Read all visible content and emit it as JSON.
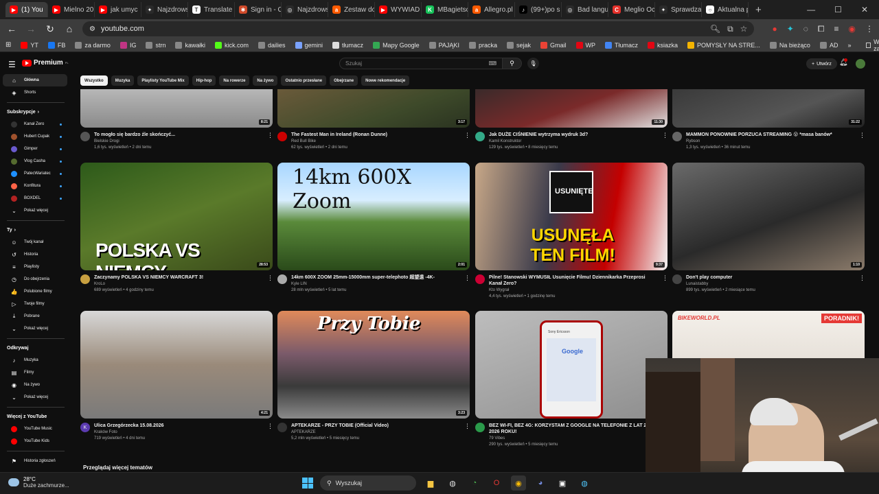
{
  "browser": {
    "tabs": [
      {
        "label": "(1) You",
        "color": "#ff0000",
        "glyph": "▶",
        "active": true
      },
      {
        "label": "Mielno 20",
        "color": "#ff0000",
        "glyph": "▶"
      },
      {
        "label": "jak umyc",
        "color": "#ff0000",
        "glyph": "▶"
      },
      {
        "label": "Najzdrows",
        "color": "#2a2a2a",
        "glyph": "✦"
      },
      {
        "label": "Translate",
        "color": "#ffffff",
        "glyph": "T"
      },
      {
        "label": "Sign in - C",
        "color": "#d04a2a",
        "glyph": "✱"
      },
      {
        "label": "Najzdrows",
        "color": "#2a2a2a",
        "glyph": "◎"
      },
      {
        "label": "Zestaw do",
        "color": "#ff5a00",
        "glyph": "a"
      },
      {
        "label": "WYWIAD",
        "color": "#ff0000",
        "glyph": "▶"
      },
      {
        "label": "MBagietsc",
        "color": "#17c35a",
        "glyph": "K"
      },
      {
        "label": "Allegro.pl",
        "color": "#ff5a00",
        "glyph": "a"
      },
      {
        "label": "(99+)po s",
        "color": "#000000",
        "glyph": "♪"
      },
      {
        "label": "Bad langu",
        "color": "#2a2a2a",
        "glyph": "◎"
      },
      {
        "label": "Meglio Oc",
        "color": "#e5302a",
        "glyph": "C"
      },
      {
        "label": "Sprawdza",
        "color": "#2a2a2a",
        "glyph": "✦"
      },
      {
        "label": "Aktualna p",
        "color": "#ffffff",
        "glyph": "○"
      }
    ],
    "url": "youtube.com",
    "bookmarks": [
      {
        "label": "YT",
        "color": "#ff0000"
      },
      {
        "label": "FB",
        "color": "#1877f2"
      },
      {
        "label": "za darmo",
        "color": "#888888"
      },
      {
        "label": "IG",
        "color": "#c13584"
      },
      {
        "label": "strn",
        "color": "#888888"
      },
      {
        "label": "kawałki",
        "color": "#888888"
      },
      {
        "label": "kick.com",
        "color": "#53fc18"
      },
      {
        "label": "dailies",
        "color": "#888888"
      },
      {
        "label": "gemini",
        "color": "#7aa2ff"
      },
      {
        "label": "tłumacz",
        "color": "#dddddd"
      },
      {
        "label": "Mapy Google",
        "color": "#34a853"
      },
      {
        "label": "PAJĄKI",
        "color": "#888888"
      },
      {
        "label": "pracka",
        "color": "#888888"
      },
      {
        "label": "sejak",
        "color": "#888888"
      },
      {
        "label": "Gmail",
        "color": "#ea4335"
      },
      {
        "label": "WP",
        "color": "#e20613"
      },
      {
        "label": "Tłumacz",
        "color": "#4285f4"
      },
      {
        "label": "ksiazka",
        "color": "#e20613"
      },
      {
        "label": "POMYSŁY NA STRE...",
        "color": "#f4b400"
      },
      {
        "label": "Na bieżąco",
        "color": "#888888"
      },
      {
        "label": "AD",
        "color": "#888888"
      }
    ],
    "all_bookmarks": "Wszystkie zakładki"
  },
  "youtube": {
    "logo_label": "Premium",
    "logo_sup": "PL",
    "search_placeholder": "Szukaj",
    "create_label": "Utwórz",
    "chips": [
      "Wszystko",
      "Muzyka",
      "Playlisty YouTube Mix",
      "Hip-hop",
      "Na rowerze",
      "Na żywo",
      "Ostatnio przesłane",
      "Obejrzane",
      "Nowe rekomendacje"
    ],
    "sidebar": {
      "main": [
        {
          "label": "Główna",
          "icon": "⌂",
          "active": true
        },
        {
          "label": "Shorts",
          "icon": "◈"
        }
      ],
      "subs_title": "Subskrypcje",
      "subs": [
        {
          "label": "Kanał Zero",
          "color": "#333333"
        },
        {
          "label": "Hubert Cupak",
          "color": "#a0522d"
        },
        {
          "label": "Gimper",
          "color": "#6a5acd"
        },
        {
          "label": "Vlog Casha",
          "color": "#556b2f"
        },
        {
          "label": "PatecWariatec",
          "color": "#1e90ff"
        },
        {
          "label": "Konfitura",
          "color": "#ff6347"
        },
        {
          "label": "BOXDEL",
          "color": "#b22222"
        }
      ],
      "subs_more": "Pokaż więcej",
      "you_title": "Ty",
      "you": [
        {
          "label": "Twój kanał",
          "icon": "☺"
        },
        {
          "label": "Historia",
          "icon": "↺"
        },
        {
          "label": "Playlisty",
          "icon": "≡"
        },
        {
          "label": "Do obejrzenia",
          "icon": "◷"
        },
        {
          "label": "Polubione filmy",
          "icon": "👍"
        },
        {
          "label": "Twoje filmy",
          "icon": "▷"
        },
        {
          "label": "Pobrane",
          "icon": "⤓"
        },
        {
          "label": "Pokaż więcej",
          "icon": "⌄"
        }
      ],
      "explore_title": "Odkrywaj",
      "explore": [
        {
          "label": "Muzyka",
          "icon": "♪"
        },
        {
          "label": "Filmy",
          "icon": "▤"
        },
        {
          "label": "Na żywo",
          "icon": "◉"
        },
        {
          "label": "Pokaż więcej",
          "icon": "⌄"
        }
      ],
      "more_title": "Więcej z YouTube",
      "more": [
        {
          "label": "YouTube Music",
          "color": "#ff0000"
        },
        {
          "label": "YouTube Kids",
          "color": "#ff0000"
        }
      ],
      "report": {
        "label": "Historia zgłoszeń",
        "icon": "⚑"
      }
    },
    "videos_row0": [
      {
        "title": "To mogło się bardzo źle skończyć...",
        "channel": "Bielskie Drogi",
        "stats": "1,6 tys. wyświetleń • 2 dni temu",
        "duration": "8:21"
      },
      {
        "title": "The Fastest Man in Ireland (Ronan Dunne)",
        "channel": "Red Bull Bike",
        "stats": "62 tys. wyświetleń • 2 dni temu",
        "duration": "3:17"
      },
      {
        "title": "Jak DUŻE CIŚNIENIE wytrzyma wydruk 3d?",
        "channel": "Kamil Konstruktor",
        "stats": "129 tys. wyświetleń • 8 miesięcy temu",
        "duration": "11:30"
      },
      {
        "title": "MAMMON PONOWNIE PORZUCA STREAMING 😮 *masa banów*",
        "channel": "Rybson",
        "stats": "1,3 tys. wyświetleń • 36 minut temu",
        "duration": "31:22"
      }
    ],
    "videos_row1": [
      {
        "title": "Zaczynamy POLSKA VS NIEMCY WARCRAFT 3!",
        "channel": "KroLo",
        "stats": "689 wyświetleń • 4 godziny temu",
        "duration": "28:53",
        "overlay": "POLSKA VS NIEMCY"
      },
      {
        "title": "14km 600X ZOOM  25mm-15000mm super-telephoto 超望遠 -4K-",
        "channel": "Kyle LIN",
        "stats": "28 mln wyświetleń • 5 lat temu",
        "duration": "2:01",
        "overlay": "14km 600X Zoom"
      },
      {
        "title": "Pilne! Stanowski WYMUSIŁ Usunięcie Filmu! Dziennikarka Przeprosi Kanał Zero?",
        "channel": "Kto Wygrał",
        "stats": "4,4 tys. wyświetleń • 1 godzinę temu",
        "duration": "9:37",
        "overlay": "USUNĘŁA TEN FILM!",
        "overlay2": "USUNIĘTE"
      },
      {
        "title": "Don't play computer",
        "channel": "Lunaistabby",
        "stats": "899 tys. wyświetleń • 2 miesiące temu",
        "duration": "1:10"
      }
    ],
    "videos_row2": [
      {
        "title": "Ulica Grzegórzecka 15.08.2026",
        "channel": "Kraków Foto",
        "stats": "719 wyświetleń • 4 dni temu",
        "duration": "4:21",
        "avatar_letter": "K"
      },
      {
        "title": "APTEKARZE - PRZY TOBIE (Official Video)",
        "channel": "APTEKARZE",
        "stats": "5,2 mln wyświetleń • 5 miesięcy temu",
        "duration": "3:23",
        "overlay": "Przy Tobie"
      },
      {
        "title": "BEZ WI-FI, BEZ 4G: KORZYSTAM Z GOOGLE NA TELEFONIE Z LAT 2000. 2026 ROKU!",
        "channel": "79 Vibes",
        "stats": "290 tys. wyświetleń • 5 miesięcy temu",
        "duration": "",
        "overlay_brand": "Sony Ericsson",
        "overlay_search": "Google"
      },
      {
        "title": "",
        "channel": "",
        "stats": "",
        "duration": "",
        "overlay_brand": "BIKEWORLD.PL",
        "overlay_badge": "PORADNIK!"
      }
    ],
    "browse_more": "Przeglądaj więcej tematów"
  },
  "taskbar": {
    "temp": "28°C",
    "weather": "Duże zachmurze...",
    "search": "Wyszukaj"
  }
}
